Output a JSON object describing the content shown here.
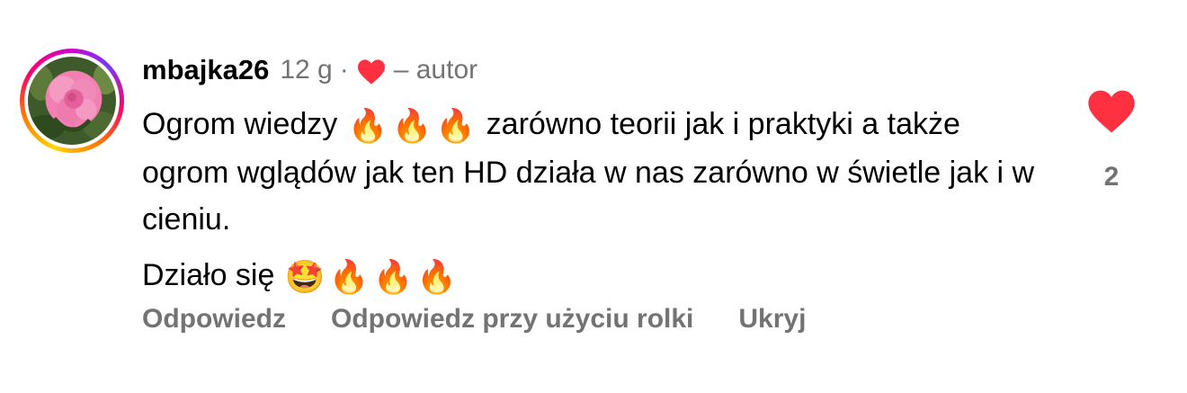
{
  "comment": {
    "username": "mbajka26",
    "time": "12 g",
    "separator": "·",
    "author_tag": "– autor",
    "paragraph1_parts": [
      "Ogrom wiedzy",
      "zarówno teorii jak i praktyki a także ogrom wglądów jak ten HD działa w nas zarówno w świetle jak i w cieniu."
    ],
    "paragraph2_text": "Działo się",
    "emoji": {
      "fire": "🔥",
      "star_struck": "🤩"
    },
    "like_count": "2"
  },
  "actions": {
    "reply": "Odpowiedz",
    "reply_with_reel": "Odpowiedz przy użyciu rolki",
    "hide": "Ukryj"
  },
  "colors": {
    "heart": "#ff3040",
    "muted": "#737373",
    "text": "#000000"
  },
  "icons": {
    "author_heart": "heart-icon",
    "like": "heart-icon",
    "avatar": "flower-avatar"
  }
}
